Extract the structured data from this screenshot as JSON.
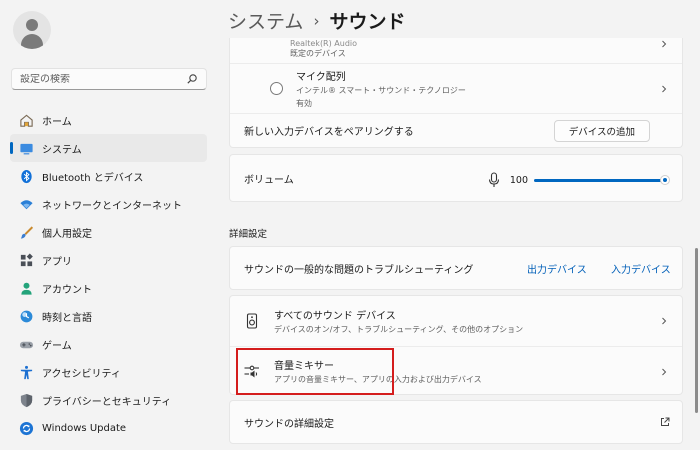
{
  "header": {
    "parent": "システム",
    "separator": "›",
    "current": "サウンド"
  },
  "search": {
    "placeholder": "設定の検索"
  },
  "sidebar": {
    "items": [
      {
        "label": "ホーム",
        "icon": "home-icon"
      },
      {
        "label": "システム",
        "icon": "system-icon",
        "active": true
      },
      {
        "label": "Bluetooth とデバイス",
        "icon": "bluetooth-icon"
      },
      {
        "label": "ネットワークとインターネット",
        "icon": "wifi-icon"
      },
      {
        "label": "個人用設定",
        "icon": "brush-icon"
      },
      {
        "label": "アプリ",
        "icon": "apps-icon"
      },
      {
        "label": "アカウント",
        "icon": "account-icon"
      },
      {
        "label": "時刻と言語",
        "icon": "clock-globe-icon"
      },
      {
        "label": "ゲーム",
        "icon": "gamepad-icon"
      },
      {
        "label": "アクセシビリティ",
        "icon": "accessibility-icon"
      },
      {
        "label": "プライバシーとセキュリティ",
        "icon": "shield-icon"
      },
      {
        "label": "Windows Update",
        "icon": "update-icon"
      }
    ]
  },
  "input_devices": {
    "partial_title": "Realtek(R) Audio",
    "partial_sub": "既定のデバイス",
    "mic": {
      "title": "マイク配列",
      "sub1": "インテル® スマート・サウンド・テクノロジー",
      "sub2": "有効"
    },
    "pair_label": "新しい入力デバイスをペアリングする",
    "add_button": "デバイスの追加"
  },
  "volume": {
    "label": "ボリューム",
    "value": "100",
    "level": 100
  },
  "advanced": {
    "section_title": "詳細設定",
    "troubleshoot": {
      "label": "サウンドの一般的な問題のトラブルシューティング",
      "output_link": "出力デバイス",
      "input_link": "入力デバイス"
    },
    "all_devices": {
      "title": "すべてのサウンド デバイス",
      "sub": "デバイスのオン/オフ、トラブルシューティング、その他のオプション"
    },
    "mixer": {
      "title": "音量ミキサー",
      "sub": "アプリの音量ミキサー、アプリの入力および出力デバイス"
    },
    "more_settings": {
      "label": "サウンドの詳細設定"
    }
  },
  "colors": {
    "accent": "#0067c0",
    "highlight": "#d41d1d",
    "link": "#005fb8"
  }
}
